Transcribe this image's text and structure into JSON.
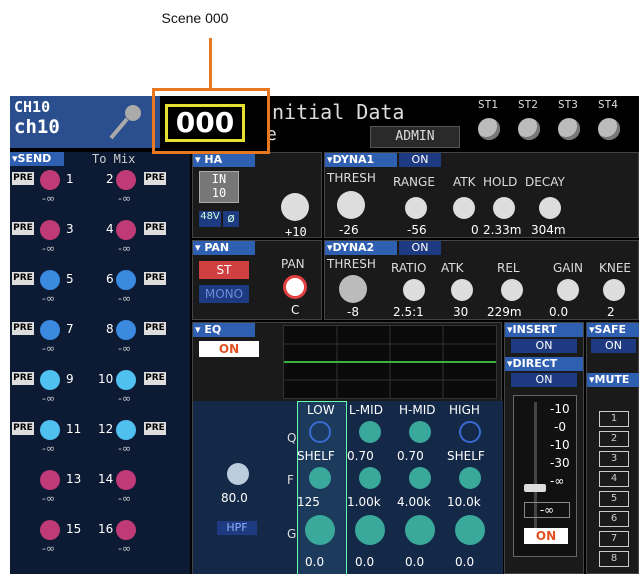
{
  "callout": {
    "label": "Scene 000"
  },
  "header": {
    "channel_number": "CH10",
    "channel_name": "ch10",
    "scene_number": "000",
    "scene_title": "nitial Data",
    "scene_title_suffix": "e",
    "user": "ADMIN",
    "stereo_labels": [
      "ST1",
      "ST2",
      "ST3",
      "ST4"
    ]
  },
  "send": {
    "title": "SEND",
    "to_mix": "To Mix",
    "pre_label": "PRE",
    "rows": [
      {
        "left": "1",
        "right": "2",
        "left_pre": true,
        "right_pre": true,
        "level": "-∞"
      },
      {
        "left": "3",
        "right": "4",
        "left_pre": true,
        "right_pre": true,
        "level": "-∞"
      },
      {
        "left": "5",
        "right": "6",
        "left_pre": true,
        "right_pre": true,
        "level": "-∞"
      },
      {
        "left": "7",
        "right": "8",
        "left_pre": true,
        "right_pre": true,
        "level": "-∞"
      },
      {
        "left": "9",
        "right": "10",
        "left_pre": true,
        "right_pre": true,
        "level": "-∞"
      },
      {
        "left": "11",
        "right": "12",
        "left_pre": true,
        "right_pre": true,
        "level": "-∞"
      },
      {
        "left": "13",
        "right": "14",
        "left_pre": false,
        "right_pre": false,
        "level": "-∞"
      },
      {
        "left": "15",
        "right": "16",
        "left_pre": false,
        "right_pre": false,
        "level": "-∞"
      }
    ]
  },
  "ha": {
    "title": "HA",
    "in": "IN",
    "in_num": "10",
    "phantom": "48V",
    "phase": "ø",
    "gain": "+10"
  },
  "pan": {
    "title": "PAN",
    "st": "ST",
    "mono": "MONO",
    "label": "PAN",
    "value": "C"
  },
  "dyna1": {
    "title": "DYNA1",
    "state": "ON",
    "labels": [
      "THRESH",
      "RANGE",
      "ATK",
      "HOLD",
      "DECAY"
    ],
    "values": [
      "-26",
      "-56",
      "0",
      "2.33m",
      "304m"
    ]
  },
  "dyna2": {
    "title": "DYNA2",
    "state": "ON",
    "labels": [
      "THRESH",
      "RATIO",
      "ATK",
      "REL",
      "GAIN",
      "KNEE"
    ],
    "values": [
      "-8",
      "2.5:1",
      "30",
      "229m",
      "0.0",
      "2"
    ]
  },
  "eq": {
    "title": "EQ",
    "state": "ON",
    "bands": [
      "LOW",
      "L-MID",
      "H-MID",
      "HIGH"
    ],
    "q_label": "Q",
    "f_label": "F",
    "g_label": "G",
    "q_values": [
      "SHELF",
      "0.70",
      "0.70",
      "SHELF"
    ],
    "f_values": [
      "125",
      "1.00k",
      "4.00k",
      "10.0k"
    ],
    "g_values": [
      "0.0",
      "0.0",
      "0.0",
      "0.0"
    ],
    "hpf_value": "80.0",
    "hpf": "HPF"
  },
  "insert": {
    "title": "INSERT",
    "state": "ON"
  },
  "direct": {
    "title": "DIRECT",
    "state": "ON"
  },
  "fader": {
    "scale": [
      "10",
      "0",
      "10",
      "30",
      "∞"
    ],
    "value": "-∞",
    "on": "ON"
  },
  "safe": {
    "title": "SAFE",
    "state": "ON"
  },
  "mute": {
    "title": "MUTE",
    "groups": [
      "1",
      "2",
      "3",
      "4",
      "5",
      "6",
      "7",
      "8"
    ]
  }
}
